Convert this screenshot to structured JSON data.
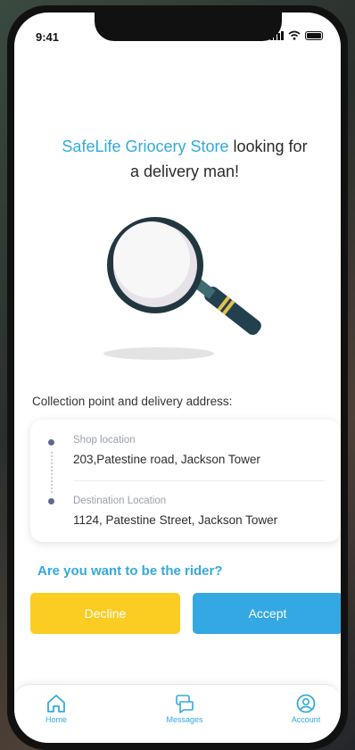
{
  "status_bar": {
    "time": "9:41"
  },
  "headline": {
    "store_name": "SafeLife Griocery Store",
    "rest": " looking for",
    "line2": "a delivery man!"
  },
  "section_label": "Collection point and delivery address:",
  "card": {
    "shop": {
      "label": "Shop location",
      "value": "203,Patestine road, Jackson Tower"
    },
    "destination": {
      "label": "Destination Location",
      "value": "1124, Patestine Street, Jackson Tower"
    }
  },
  "question": "Are you want to be the rider?",
  "buttons": {
    "decline": "Decline",
    "accept": "Accept"
  },
  "tabbar": {
    "items": [
      {
        "label": "Home",
        "icon": "home-icon"
      },
      {
        "label": "Messages",
        "icon": "messages-icon"
      },
      {
        "label": "Account",
        "icon": "account-icon"
      }
    ]
  },
  "colors": {
    "accent": "#33a9e0",
    "decline": "#fbcd23",
    "accept": "#34a8e3"
  }
}
